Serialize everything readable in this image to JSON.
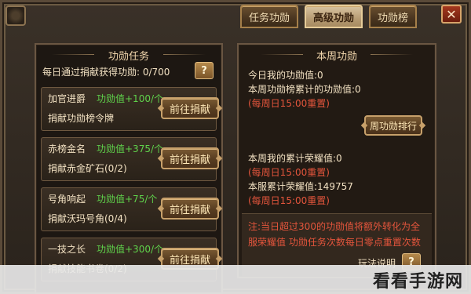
{
  "window": {
    "close_label": "✕",
    "colors": {
      "accent": "#c7a06a",
      "merit_green": "#5fd24b",
      "notice_red": "#e4553c"
    }
  },
  "tabs": [
    {
      "label": "任务功勋",
      "active": false
    },
    {
      "label": "高级功勋",
      "active": true
    },
    {
      "label": "功勋榜",
      "active": false
    }
  ],
  "left_panel": {
    "title": "功勋任务",
    "daily_text": "每日通过捐献获得功勋: 0/700",
    "help_label": "?",
    "tasks": [
      {
        "name": "加官进爵",
        "merit": "功勋值+100/个",
        "desc": "捐献功勋榜令牌",
        "button": "前往捐献"
      },
      {
        "name": "赤榜金名",
        "merit": "功勋值+375/个",
        "desc": "捐献赤金矿石(0/2)",
        "button": "前往捐献"
      },
      {
        "name": "号角响起",
        "merit": "功勋值+75/个",
        "desc": "捐献沃玛号角(0/4)",
        "button": "前往捐献"
      },
      {
        "name": "一技之长",
        "merit": "功勋值+300/个",
        "desc": "捐献技能书卷(0/2)",
        "button": "前往捐献"
      }
    ]
  },
  "right_panel": {
    "title": "本周功勋",
    "today_merit": "今日我的功勋值:0",
    "week_rank_merit": "本周功勋榜累计的功勋值:0",
    "reset1": "(每周日15:00重置)",
    "rank_button": "周功勋排行",
    "my_honor": "本周我的累计荣耀值:0",
    "reset2": "(每周日15:00重置)",
    "server_honor": "本服累计荣耀值:149757",
    "reset3": "(每周日15:00重置)",
    "notice": "注:当日超过300的功勋值将额外转化为全服荣耀值 功勋任务次数每日零点重置次数",
    "help_text": "玩法说明",
    "help_button": "?"
  },
  "watermark": "看看手游网"
}
